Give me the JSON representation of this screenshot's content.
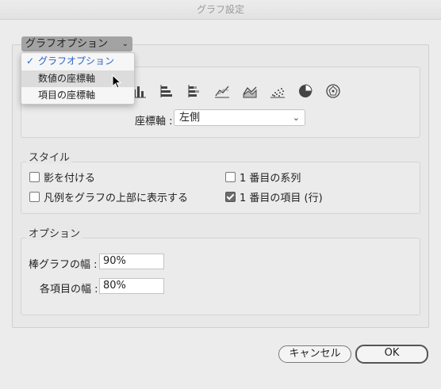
{
  "window": {
    "title": "グラフ設定"
  },
  "dropdown": {
    "current": "グラフオプション",
    "items": [
      {
        "label": "グラフオプション",
        "selected": true
      },
      {
        "label": "数値の座標軸",
        "selected": false
      },
      {
        "label": "項目の座標軸",
        "selected": false
      }
    ]
  },
  "chart_types": {
    "icons": [
      "stacked-column-icon",
      "bar-icon",
      "stacked-bar-icon",
      "line-icon",
      "area-icon",
      "scatter-icon",
      "pie-icon",
      "radar-icon"
    ]
  },
  "axis": {
    "label": "座標軸 :",
    "value": "左側"
  },
  "style": {
    "legend": "スタイル",
    "shadow": {
      "label": "影を付ける",
      "checked": false
    },
    "legend_top": {
      "label": "凡例をグラフの上部に表示する",
      "checked": false
    },
    "first_series": {
      "label": "1 番目の系列",
      "checked": false
    },
    "first_item": {
      "label": "1 番目の項目 (行)",
      "checked": true
    }
  },
  "options": {
    "legend": "オプション",
    "bar_width_label": "棒グラフの幅 :",
    "bar_width_value": "90%",
    "item_width_label": "各項目の幅 :",
    "item_width_value": "80%"
  },
  "buttons": {
    "cancel": "キャンセル",
    "ok": "OK"
  }
}
